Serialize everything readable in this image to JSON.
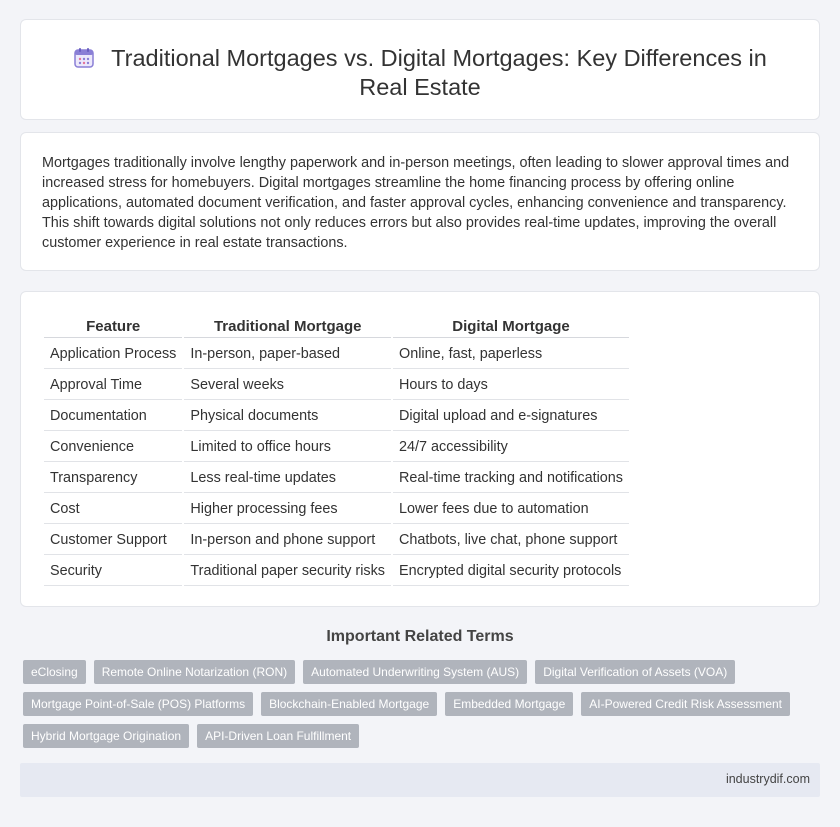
{
  "header": {
    "title": "Traditional Mortgages vs. Digital Mortgages: Key Differences in Real Estate",
    "icon": "calendar-icon",
    "icon_color": "#8a7fd6"
  },
  "intro": {
    "text": "Mortgages traditionally involve lengthy paperwork and in-person meetings, often leading to slower approval times and increased stress for homebuyers. Digital mortgages streamline the home financing process by offering online applications, automated document verification, and faster approval cycles, enhancing convenience and transparency. This shift towards digital solutions not only reduces errors but also provides real-time updates, improving the overall customer experience in real estate transactions."
  },
  "table": {
    "headers": [
      "Feature",
      "Traditional Mortgage",
      "Digital Mortgage"
    ],
    "rows": [
      [
        "Application Process",
        "In-person, paper-based",
        "Online, fast, paperless"
      ],
      [
        "Approval Time",
        "Several weeks",
        "Hours to days"
      ],
      [
        "Documentation",
        "Physical documents",
        "Digital upload and e-signatures"
      ],
      [
        "Convenience",
        "Limited to office hours",
        "24/7 accessibility"
      ],
      [
        "Transparency",
        "Less real-time updates",
        "Real-time tracking and notifications"
      ],
      [
        "Cost",
        "Higher processing fees",
        "Lower fees due to automation"
      ],
      [
        "Customer Support",
        "In-person and phone support",
        "Chatbots, live chat, phone support"
      ],
      [
        "Security",
        "Traditional paper security risks",
        "Encrypted digital security protocols"
      ]
    ]
  },
  "related": {
    "title": "Important Related Terms",
    "terms": [
      "eClosing",
      "Remote Online Notarization (RON)",
      "Automated Underwriting System (AUS)",
      "Digital Verification of Assets (VOA)",
      "Mortgage Point-of-Sale (POS) Platforms",
      "Blockchain-Enabled Mortgage",
      "Embedded Mortgage",
      "AI-Powered Credit Risk Assessment",
      "Hybrid Mortgage Origination",
      "API-Driven Loan Fulfillment"
    ]
  },
  "footer": {
    "site": "industrydif.com"
  }
}
